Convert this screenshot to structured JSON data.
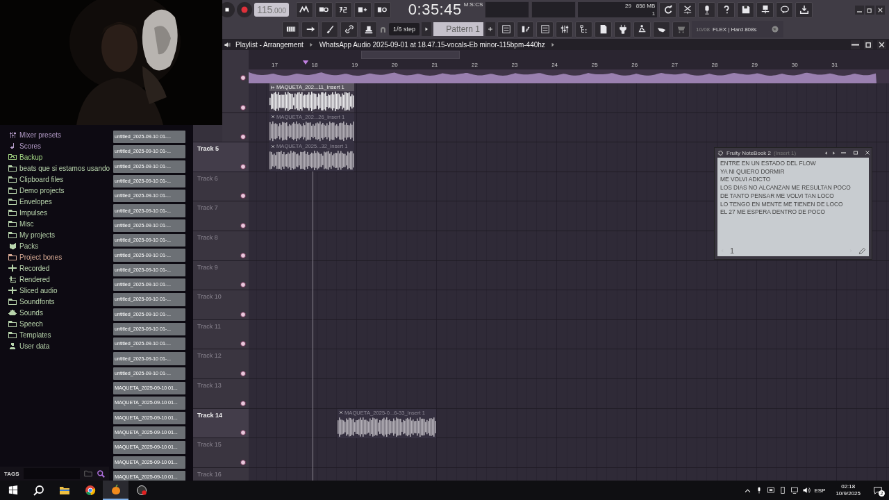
{
  "toolbar": {
    "tempo": "115",
    "tempo_decimals": ".000",
    "time": "0:35:45",
    "time_format": "M:S:CS",
    "cpu": "29",
    "memory": "858 MB",
    "polyphony": "1",
    "snap": "1/6 step",
    "pattern": "Pattern 1",
    "hint_count": "10/08",
    "hint": "FLEX | Hard 808s"
  },
  "browser": {
    "items": [
      {
        "label": "Mixer presets",
        "kind": "mixer",
        "color": "#b49cc8"
      },
      {
        "label": "Scores",
        "kind": "note",
        "color": "#b49cc8"
      },
      {
        "label": "Backup",
        "kind": "backup",
        "color": "#a4d884"
      },
      {
        "label": "beats que si estamos usando",
        "kind": "folder",
        "color": "#b8d4ac"
      },
      {
        "label": "Clipboard files",
        "kind": "folder",
        "color": "#b8d4ac"
      },
      {
        "label": "Demo projects",
        "kind": "folder",
        "color": "#b8d4ac"
      },
      {
        "label": "Envelopes",
        "kind": "folder",
        "color": "#b8d4ac"
      },
      {
        "label": "Impulses",
        "kind": "folder",
        "color": "#b8d4ac"
      },
      {
        "label": "Misc",
        "kind": "folder",
        "color": "#b8d4ac"
      },
      {
        "label": "My projects",
        "kind": "folder",
        "color": "#b8d4ac"
      },
      {
        "label": "Packs",
        "kind": "packs",
        "color": "#b8d4ac"
      },
      {
        "label": "Project bones",
        "kind": "folder",
        "color": "#d8aa94"
      },
      {
        "label": "Recorded",
        "kind": "plus",
        "color": "#b8d4ac"
      },
      {
        "label": "Rendered",
        "kind": "rendered",
        "color": "#b8d4ac"
      },
      {
        "label": "Sliced audio",
        "kind": "plus",
        "color": "#b8d4ac"
      },
      {
        "label": "Soundfonts",
        "kind": "folder",
        "color": "#b8d4ac"
      },
      {
        "label": "Sounds",
        "kind": "cloud",
        "color": "#b8d4ac"
      },
      {
        "label": "Speech",
        "kind": "folder",
        "color": "#b8d4ac"
      },
      {
        "label": "Templates",
        "kind": "folder",
        "color": "#b8d4ac"
      },
      {
        "label": "User data",
        "kind": "user",
        "color": "#b8d4ac"
      }
    ],
    "files": [
      "untitled_2025-09-10 01-...",
      "untitled_2025-09-10 01-...",
      "untitled_2025-09-10 01-...",
      "untitled_2025-09-10 01-...",
      "untitled_2025-09-10 01-...",
      "untitled_2025-09-10 01-...",
      "untitled_2025-09-10 01-...",
      "untitled_2025-09-10 01-...",
      "untitled_2025-09-10 01-...",
      "untitled_2025-09-10 01-...",
      "untitled_2025-09-10 01-...",
      "untitled_2025-09-10 01-...",
      "untitled_2025-09-10 01-...",
      "untitled_2025-09-10 01-...",
      "untitled_2025-09-10 01-...",
      "untitled_2025-09-10 01-...",
      "untitled_2025-09-10 01-...",
      "MAQUETA_2025-09-10 01...",
      "MAQUETA_2025-09-10 01...",
      "MAQUETA_2025-09-10 01...",
      "MAQUETA_2025-09-10 01...",
      "MAQUETA_2025-09-10 01...",
      "MAQUETA_2025-09-10 01...",
      "MAQUETA_2025-09-10 01..."
    ],
    "tags_label": "TAGS"
  },
  "playlist": {
    "title": "Playlist - Arrangement",
    "pattern_path": "WhatsApp Audio 2025-09-01 at 18.47.15-vocals-Eb minor-115bpm-440hz",
    "ruler": [
      "17",
      "18",
      "19",
      "20",
      "21",
      "22",
      "23",
      "24",
      "25",
      "26",
      "27",
      "28",
      "29",
      "30",
      "31"
    ],
    "tracks": [
      {
        "active": false,
        "clip": {
          "title": "MAQUETA_202...11_Insert 1",
          "muted": false
        }
      },
      {
        "active": false,
        "clip": {
          "title": "MAQUETA_202...26_Insert 1",
          "muted": true
        }
      },
      {
        "label": "Track 5",
        "active": true,
        "clip": {
          "title": "MAQUETA_2025...32_Insert 1",
          "muted": true
        }
      },
      {
        "label": "Track 6",
        "active": false
      },
      {
        "label": "Track 7",
        "active": false
      },
      {
        "label": "Track 8",
        "active": false
      },
      {
        "label": "Track 9",
        "active": false
      },
      {
        "label": "Track 10",
        "active": false
      },
      {
        "label": "Track 11",
        "active": false
      },
      {
        "label": "Track 12",
        "active": false
      },
      {
        "label": "Track 13",
        "active": false
      },
      {
        "label": "Track 14",
        "active": true,
        "clip": {
          "title": "MAQUETA_2025-0...6-33_Insert 1",
          "muted": true
        }
      },
      {
        "label": "Track 15",
        "active": false
      },
      {
        "label": "Track 16",
        "active": false
      }
    ]
  },
  "notebook": {
    "title": "Fruity NoteBook 2",
    "subtitle": "(Insert 1)",
    "text": "ENTRE EN UN ESTADO DEL FLOW\nYA NI QUIERO DORMIR\nME VOLVI ADICTO\nLOS DIAS NO ALCANZAN ME RESULTAN POCO\nDE TANTO PENSAR ME VOLVI TAN LOCO\nLO TENGO EN MENTE ME TIENEN DE LOCO\nEL 27 ME ESPERA DENTRO DE POCO",
    "page": "1"
  },
  "taskbar": {
    "language": "ESP",
    "time": "02:18",
    "date": "10/9/2025",
    "notifications": "2"
  }
}
